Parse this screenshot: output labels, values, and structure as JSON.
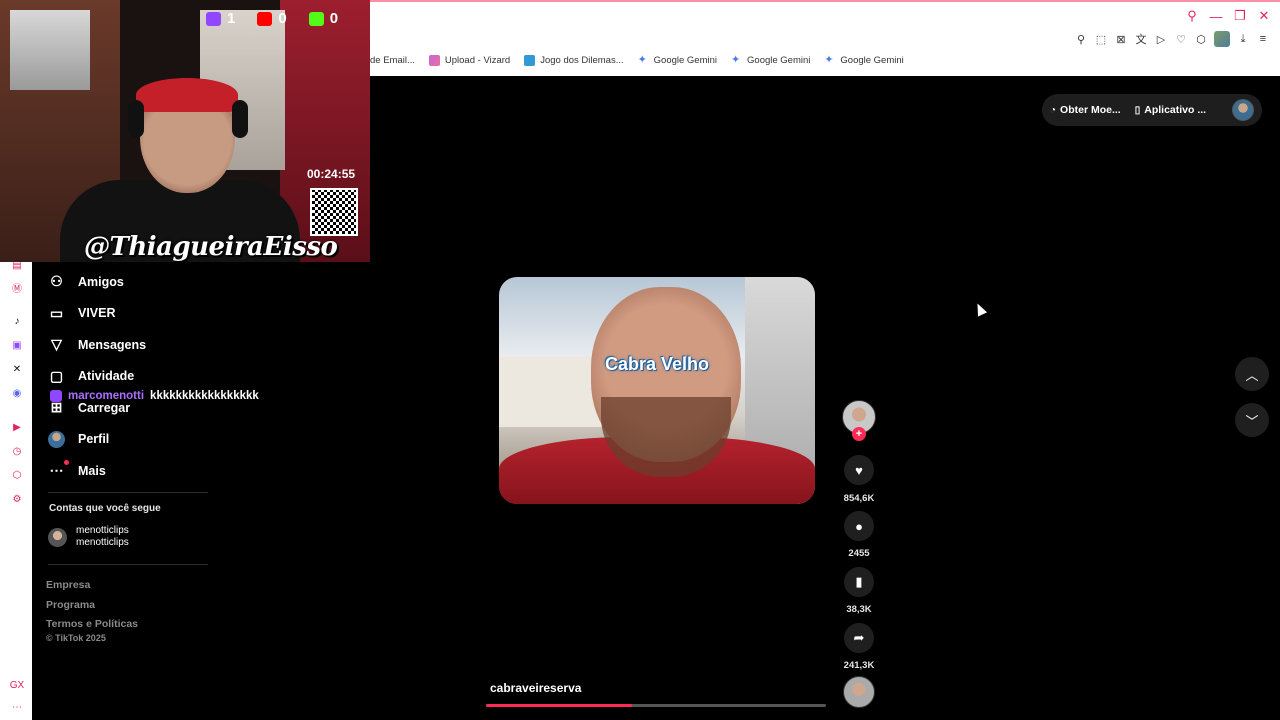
{
  "bookmarks": [
    {
      "label": "de Email...",
      "icon": "mail-icon"
    },
    {
      "label": "Upload - Vizard",
      "icon": "vizard-icon"
    },
    {
      "label": "Jogo dos Dilemas...",
      "icon": "jogo-icon"
    },
    {
      "label": "Google Gemini",
      "icon": "gemini-icon"
    },
    {
      "label": "Google Gemini",
      "icon": "gemini-icon"
    },
    {
      "label": "Google Gemini",
      "icon": "gemini-icon"
    }
  ],
  "stream": {
    "counters": [
      {
        "platform": "twitch",
        "value": "1"
      },
      {
        "platform": "youtube",
        "value": "0"
      },
      {
        "platform": "kick",
        "value": "0"
      }
    ],
    "timer": "00:24:55",
    "handle": "@ThiagueiraEisso",
    "chat": {
      "user": "marcomenotti",
      "message": "kkkkkkkkkkkkkkkkk"
    }
  },
  "sidebar": {
    "items": [
      {
        "label": "Amigos",
        "icon": "friends-icon"
      },
      {
        "label": "VIVER",
        "icon": "live-icon"
      },
      {
        "label": "Mensagens",
        "icon": "messages-icon"
      },
      {
        "label": "Atividade",
        "icon": "activity-icon"
      },
      {
        "label": "Carregar",
        "icon": "upload-icon"
      },
      {
        "label": "Perfil",
        "icon": "profile-avatar"
      },
      {
        "label": "Mais",
        "icon": "more-icon"
      }
    ],
    "following_title": "Contas que você segue",
    "following": [
      {
        "name": "menotticlips",
        "handle": "menotticlips"
      }
    ],
    "footer": [
      "Empresa",
      "Programa",
      "Termos e Políticas"
    ],
    "copyright": "© TikTok 2025"
  },
  "top_pills": {
    "coins": "Obter Moe...",
    "app": "Aplicativo ..."
  },
  "video": {
    "caption": "Cabra Velho",
    "author": "cabraveireserva",
    "progress": 0.43
  },
  "actions": {
    "likes": "854,6K",
    "comments": "2455",
    "saves": "38,3K",
    "shares": "241,3K"
  },
  "colors": {
    "accent": "#fe2c55",
    "twitch": "#9146ff",
    "background": "#000000"
  }
}
